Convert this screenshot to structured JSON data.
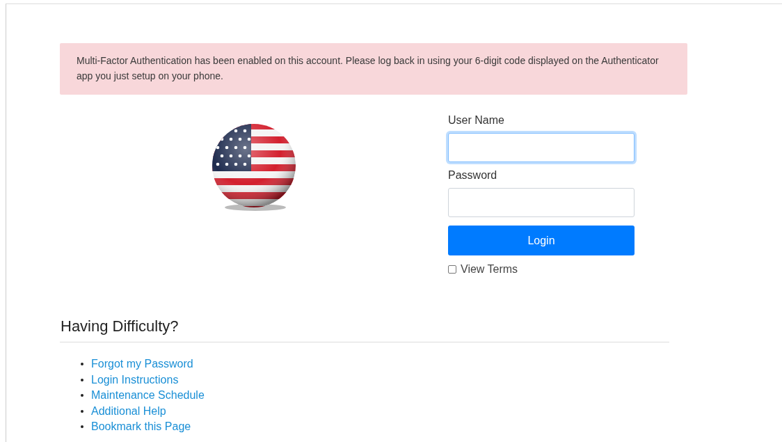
{
  "alert": {
    "message": "Multi-Factor Authentication has been enabled on this account. Please log back in using your 6-digit code displayed on the Authenticator app you just setup on your phone."
  },
  "form": {
    "username": {
      "label": "User Name",
      "focused": true
    },
    "password": {
      "label": "Password",
      "focused": false
    },
    "login_button": "Login",
    "terms": {
      "label": "View Terms",
      "checked": false
    }
  },
  "help": {
    "heading": "Having Difficulty?",
    "links": [
      {
        "label": "Forgot my Password"
      },
      {
        "label": "Login Instructions"
      },
      {
        "label": "Maintenance Schedule"
      },
      {
        "label": "Additional Help"
      },
      {
        "label": "Bookmark this Page"
      }
    ]
  }
}
